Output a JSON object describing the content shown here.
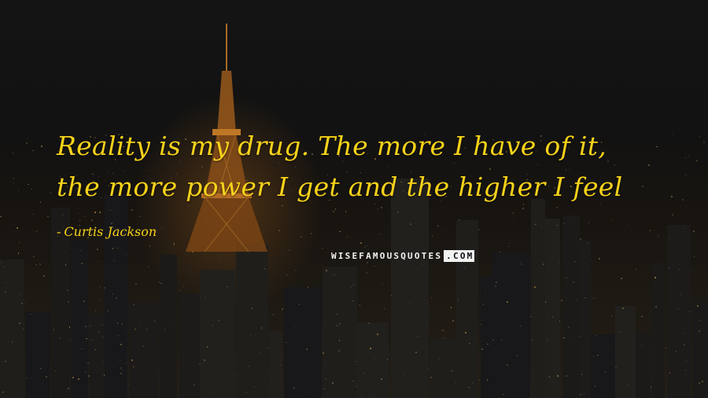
{
  "quote": {
    "line1": "Reality is my drug. The more I have of it,",
    "line2": "the more power I get and the higher I feel"
  },
  "author": {
    "dash": "-",
    "name": "Curtis Jackson"
  },
  "watermark": {
    "main": "WISEFAMOUSQUOTES",
    "suffix": ".COM"
  },
  "colors": {
    "text": "#f7d21a",
    "tower": "#d9882a",
    "background": "#121212"
  }
}
